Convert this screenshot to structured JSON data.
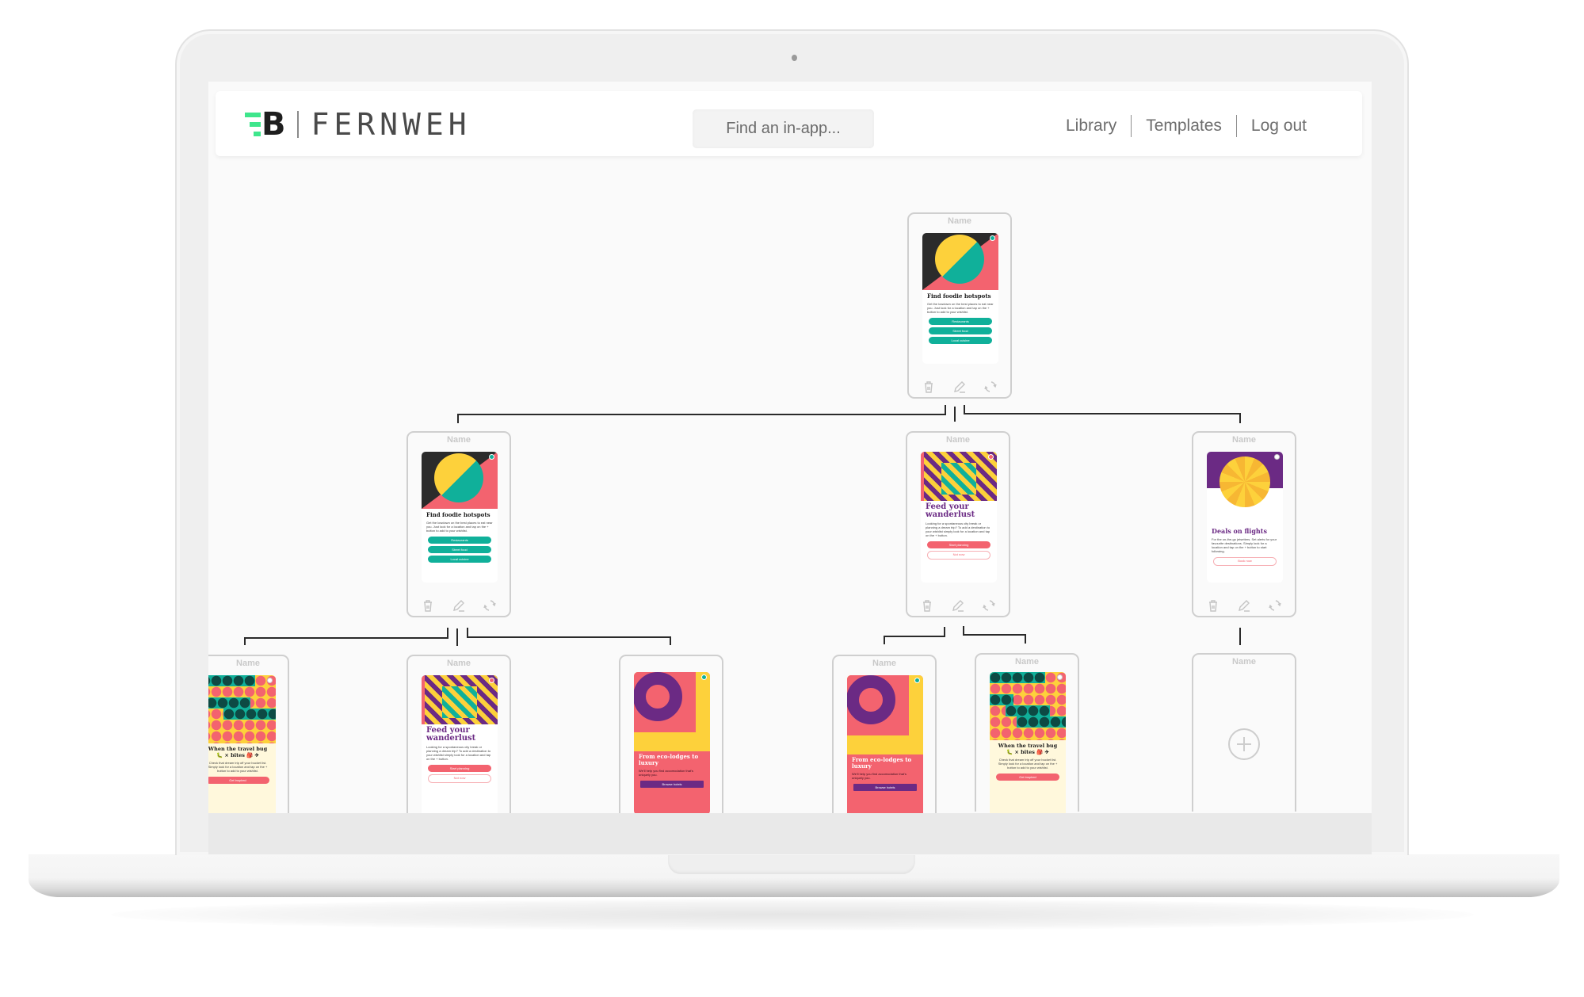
{
  "app": {
    "logo_mark": "B",
    "brand_name": "FERNWEH"
  },
  "header": {
    "search_placeholder": "Find an in-app...",
    "nav": [
      {
        "label": "Library"
      },
      {
        "label": "Templates"
      },
      {
        "label": "Log out"
      }
    ]
  },
  "colors": {
    "accent_green": "#3ee68c",
    "teal": "#10b09a",
    "coral": "#f3636f",
    "yellow": "#fdd13b",
    "purple": "#6b2a84"
  },
  "card_actions": {
    "icons": [
      "trash-icon",
      "pencil-icon",
      "swap-icon"
    ]
  },
  "tree": {
    "root": {
      "name_label": "Name",
      "template": "foodie"
    },
    "level2": [
      {
        "name_label": "Name",
        "template": "foodie"
      },
      {
        "name_label": "Name",
        "template": "wanderlust"
      },
      {
        "name_label": "Name",
        "template": "flights"
      }
    ],
    "level3": [
      {
        "name_label": "Name",
        "template": "travel-bug"
      },
      {
        "name_label": "Name",
        "template": "wanderlust"
      },
      {
        "name_label": "",
        "template": "eco-lodges"
      },
      {
        "name_label": "Name",
        "template": "eco-lodges"
      },
      {
        "name_label": "Name",
        "template": "travel-bug"
      },
      {
        "name_label": "Name",
        "template": "empty-add"
      }
    ]
  },
  "templates": {
    "foodie": {
      "title": "Find foodie hotspots",
      "body": "Get the lowdown on the best places to eat near you. Just look for a location and tap on the + button to add to your wishlist.",
      "buttons": [
        "Restaurants",
        "Street food",
        "Local cuisine"
      ]
    },
    "wanderlust": {
      "title": "Feed your wanderlust",
      "body": "Looking for a spontaneous city break or planning a dream trip? To add a destination to your wishlist simply look for a location and tap on the + button.",
      "primary": "Start planning",
      "secondary": "Not now"
    },
    "flights": {
      "title": "Deals on flights",
      "body": "For the on-the-go jetsetters. Set alerts for your favourite destinations. Simply look for a location and tap on the + button to start following.",
      "button": "Book now"
    },
    "travel_bug": {
      "title": "When the travel bug 🐛 × bites 🎒 ✈",
      "body": "Check that dream trip off your bucket list. Simply look for a location and tap on the + button to add to your wishlist.",
      "button": "Get inspired"
    },
    "eco": {
      "title": "From eco-lodges to luxury",
      "body": "We'll help you find accomodation that's uniquely you.",
      "button": "Browse hotels"
    }
  }
}
